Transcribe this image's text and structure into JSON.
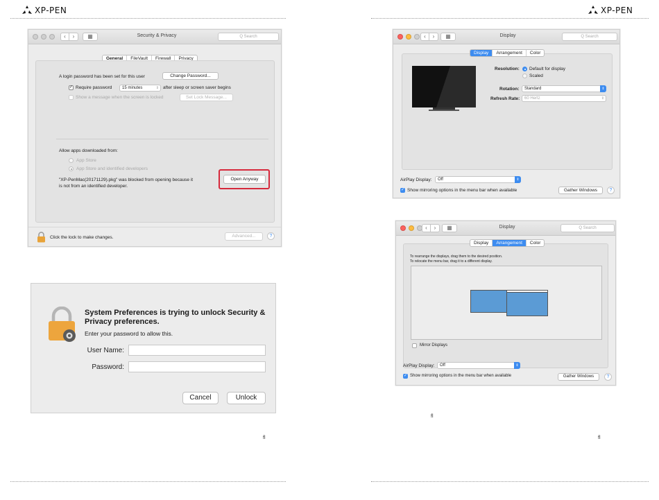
{
  "header": {
    "brand": "XP-PEN"
  },
  "footer": {
    "page_left": "fl",
    "page_right_a": "fl",
    "page_right_b": "fl"
  },
  "security_window": {
    "title": "Security & Privacy",
    "search_placeholder": "Q Search",
    "tabs": [
      "General",
      "FileVault",
      "Firewall",
      "Privacy"
    ],
    "selected_tab": "General",
    "login_password_text": "A login password has been set for this user",
    "change_password_label": "Change Password...",
    "require_password_label": "Require password",
    "require_password_value": "15 minutes",
    "after_sleep_text": "after sleep or screen saver begins",
    "show_message_label": "Show a message when the screen is locked",
    "set_lock_message_label": "Set Lock Message...",
    "allow_apps_label": "Allow apps downloaded from:",
    "option_app_store": "App Store",
    "option_identified": "App Store and identified developers",
    "blocked_text_line1": "\"XP-PenMac(20171129).pkg\" was blocked from opening because it",
    "blocked_text_line2": "is not from an identified developer.",
    "open_anyway_label": "Open Anyway",
    "lock_text": "Click the lock to make changes.",
    "advanced_label": "Advanced...",
    "help_label": "?",
    "highlight_color": "#d6283b"
  },
  "unlock_dialog": {
    "title": "System Preferences is trying to unlock Security & Privacy preferences.",
    "subtitle": "Enter your password to allow this.",
    "username_label": "User Name:",
    "password_label": "Password:",
    "cancel_label": "Cancel",
    "unlock_label": "Unlock"
  },
  "display_window_1": {
    "title": "Display",
    "search_placeholder": "Q Search",
    "tabs": [
      "Display",
      "Arrangement",
      "Color"
    ],
    "selected_tab": "Display",
    "resolution_label": "Resolution:",
    "resolution_default": "Default for display",
    "resolution_scaled": "Scaled",
    "rotation_label": "Rotation:",
    "rotation_value": "Standard",
    "refresh_label": "Refresh Rate:",
    "refresh_value": "60 Hertz",
    "airplay_label": "AirPlay Display:",
    "airplay_value": "Off",
    "mirroring_label": "Show mirroring options in the menu bar when available",
    "gather_label": "Gather Windows",
    "help_label": "?"
  },
  "display_window_2": {
    "title": "Display",
    "search_placeholder": "Q Search",
    "tabs": [
      "Display",
      "Arrangement",
      "Color"
    ],
    "selected_tab": "Arrangement",
    "instructions_line1": "To rearrange the displays, drag them to the desired position.",
    "instructions_line2": "To relocate the menu bar, drag it to a different display.",
    "mirror_label": "Mirror Displays",
    "airplay_label": "AirPlay Display:",
    "airplay_value": "Off",
    "mirroring_label": "Show mirroring options in the menu bar when available",
    "gather_label": "Gather Windows",
    "help_label": "?"
  },
  "colors": {
    "traffic_red": "#fc615d",
    "traffic_yellow": "#fdbc40",
    "traffic_green": "#34c84a",
    "accent_blue": "#3d8cf0",
    "display_blue": "#5b9bd5",
    "lock_gold": "#e8a33a"
  }
}
